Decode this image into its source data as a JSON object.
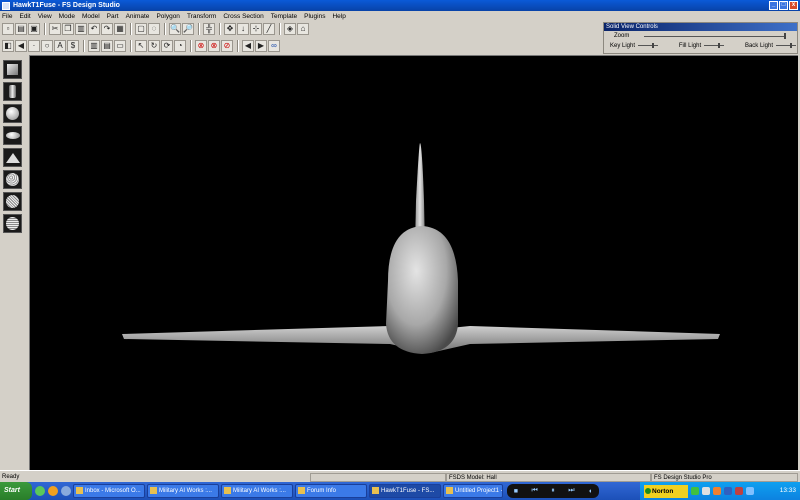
{
  "window": {
    "title": "HawkT1Fuse - FS Design Studio"
  },
  "menu": [
    "File",
    "Edit",
    "View",
    "Mode",
    "Model",
    "Part",
    "Animate",
    "Polygon",
    "Transform",
    "Cross Section",
    "Template",
    "Plugins",
    "Help"
  ],
  "solid_view": {
    "title": "Solid View Controls",
    "zoom_label": "Zoom",
    "key_light_label": "Key Light",
    "fill_light_label": "Fill Light",
    "back_light_label": "Back Light"
  },
  "status": {
    "left": "Ready",
    "model": "FSDS Model: Hall",
    "edition": "FS Design Studio Pro"
  },
  "taskbar": {
    "start_label": "Start",
    "tasks": [
      "Inbox - Microsoft O...",
      "Military AI Works :...",
      "Military AI Works :...",
      "Forum Info",
      "HawkT1Fuse - FS...",
      "Untitled Project1 -..."
    ],
    "active_index": 4,
    "norton_label": "Norton",
    "clock": "13:33"
  },
  "icons": {
    "palette": [
      "cube-icon",
      "cylinder-icon",
      "sphere-icon",
      "disc-icon",
      "cone-icon",
      "ball-icon",
      "ball-icon",
      "ball-icon"
    ]
  }
}
